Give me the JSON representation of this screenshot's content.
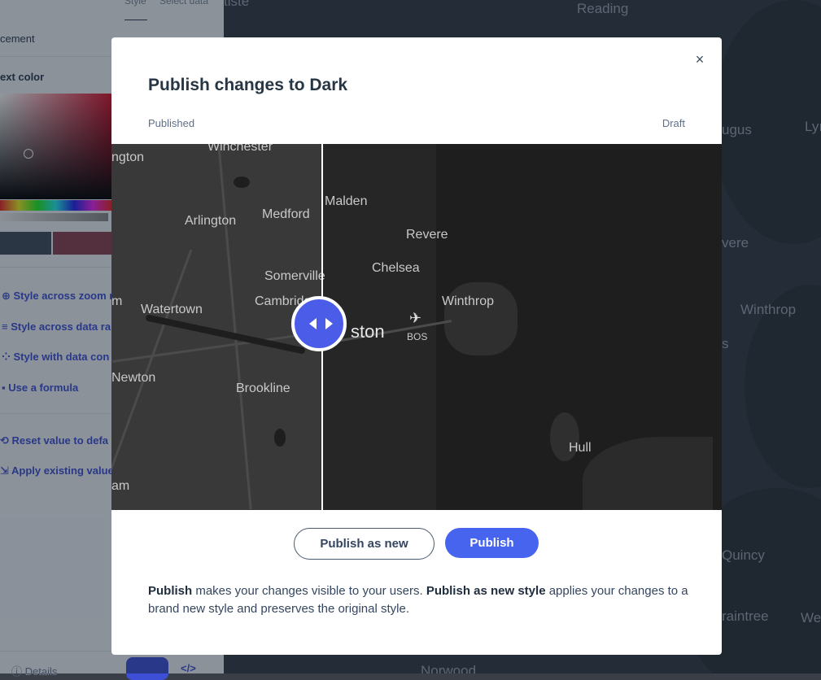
{
  "modal": {
    "title": "Publish changes to Dark",
    "close_icon": "×",
    "label_left": "Published",
    "label_right": "Draft",
    "publish_as_new_label": "Publish as new",
    "publish_label": "Publish",
    "desc": {
      "publish": "Publish",
      "text1": " makes your changes visible to your users. ",
      "publish_new": "Publish as new style",
      "text2": " applies your changes to a brand new style and preserves the original style."
    }
  },
  "compare_map": {
    "labels": {
      "winchester": "Winchester",
      "lexington": "ngton",
      "arlington": "Arlington",
      "medford": "Medford",
      "malden": "Malden",
      "revere": "Revere",
      "chelsea": "Chelsea",
      "somerville": "Somerville",
      "cambridge": "Cambridge",
      "watertown": "Watertown",
      "winthrop": "Winthrop",
      "boston": "ston",
      "airport": "BOS",
      "newton": "Newton",
      "brookline": "Brookline",
      "hull": "Hull",
      "waltham": "am",
      "belmont": "m"
    }
  },
  "background": {
    "tabs": [
      "Style",
      "Select data"
    ],
    "placement": "cement",
    "text_color": "ext color",
    "options": [
      "Style across zoom r",
      "Style across data ra",
      "Style with data con",
      "Use a formula"
    ],
    "actions": [
      "Reset value to defa",
      "Apply existing value"
    ],
    "details": "Details",
    "map_labels": {
      "reading": "Reading",
      "saugus": "ugus",
      "lynn": "Lyı",
      "revere": "vere",
      "winthrop": "Winthrop",
      "boston": "s",
      "quincy": "Quincy",
      "braintree": "raintree",
      "weymouth": "We",
      "norwood": "Norwood",
      "top": "tiste"
    }
  },
  "colors": {
    "accent": "#4664ee",
    "handle": "#4a5ce8",
    "title": "#273645"
  }
}
